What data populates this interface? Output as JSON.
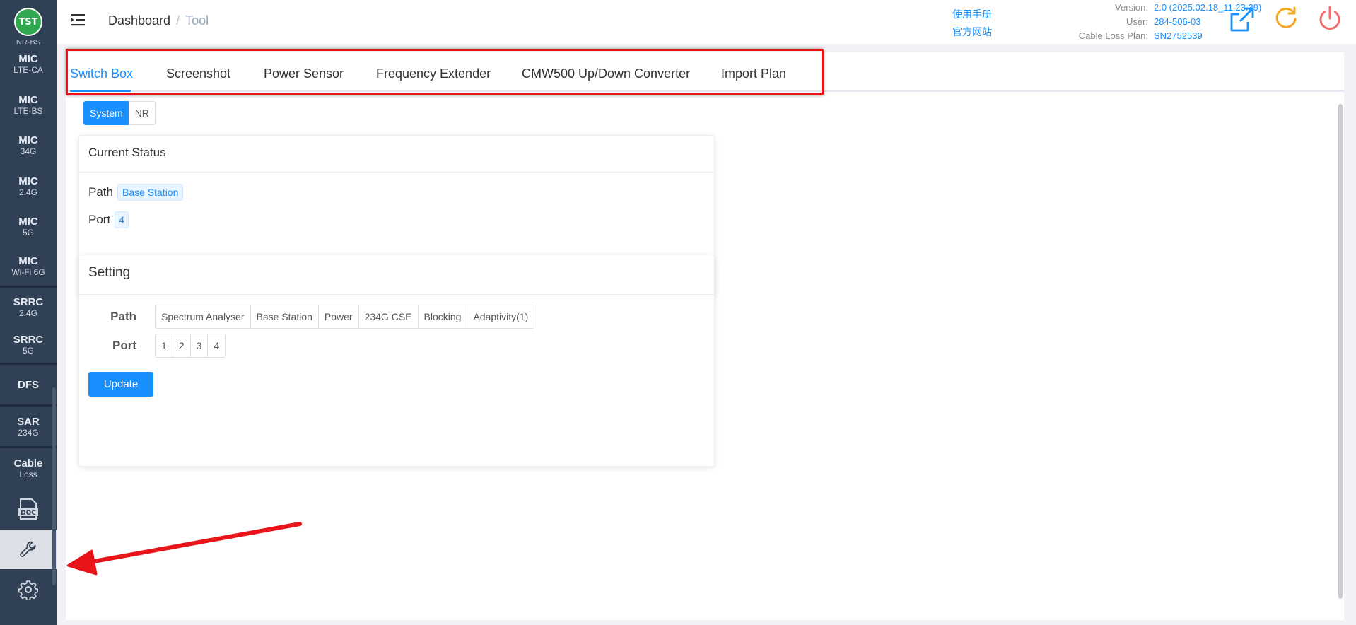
{
  "app": {
    "logo_text": "TST",
    "accent_color": "#1890ff",
    "sidebar_bg": "#304156"
  },
  "sidebar": {
    "cut_item": "NR-BS",
    "items": [
      {
        "main": "MIC",
        "sub": "LTE-CA"
      },
      {
        "main": "MIC",
        "sub": "LTE-BS"
      },
      {
        "main": "MIC",
        "sub": "34G"
      },
      {
        "main": "MIC",
        "sub": "2.4G"
      },
      {
        "main": "MIC",
        "sub": "5G"
      },
      {
        "main": "MIC",
        "sub": "Wi-Fi 6G"
      },
      {
        "main": "SRRC",
        "sub": "2.4G"
      },
      {
        "main": "SRRC",
        "sub": "5G"
      },
      {
        "main": "DFS"
      },
      {
        "main": "SAR",
        "sub": "234G"
      },
      {
        "main": "Cable",
        "sub": "Loss"
      }
    ],
    "icons": [
      "doc-icon",
      "wrench-icon",
      "gear-icon"
    ],
    "doc_icon_text": "DOC"
  },
  "header": {
    "breadcrumb": [
      "Dashboard",
      "Tool"
    ],
    "links": [
      "使用手册",
      "官方网站"
    ],
    "meta": {
      "version_label": "Version:",
      "version_value": "2.0 (2025.02.18_11.23.39)",
      "user_label": "User:",
      "user_value": "284-506-03",
      "plan_label": "Cable Loss Plan:",
      "plan_value": "SN2752539"
    },
    "actions": [
      "share-icon",
      "refresh-icon",
      "power-icon"
    ]
  },
  "tabs": [
    {
      "label": "Switch Box",
      "active": true
    },
    {
      "label": "Screenshot"
    },
    {
      "label": "Power Sensor"
    },
    {
      "label": "Frequency Extender"
    },
    {
      "label": "CMW500 Up/Down Converter"
    },
    {
      "label": "Import Plan"
    }
  ],
  "mode": {
    "options": [
      "System",
      "NR"
    ],
    "selected": "System"
  },
  "current_status": {
    "title": "Current Status",
    "path_label": "Path",
    "path_value": "Base Station",
    "port_label": "Port",
    "port_value": "4"
  },
  "setting": {
    "title": "Setting",
    "path_label": "Path",
    "path_options": [
      "Spectrum Analyser",
      "Base Station",
      "Power",
      "234G CSE",
      "Blocking",
      "Adaptivity(1)"
    ],
    "port_label": "Port",
    "port_options": [
      "1",
      "2",
      "3",
      "4"
    ],
    "update_label": "Update"
  }
}
